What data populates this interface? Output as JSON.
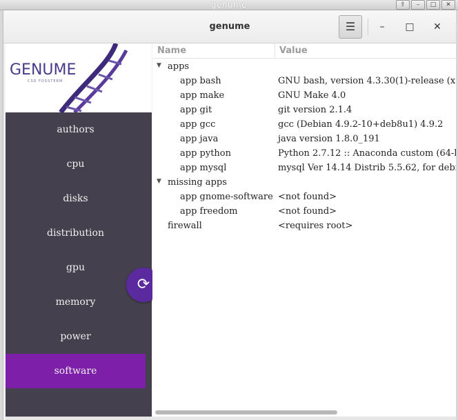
{
  "wm": {
    "title": "genume",
    "buttons": [
      "⇧",
      "–",
      "□",
      "✕"
    ]
  },
  "header": {
    "title": "genume",
    "menu_icon": "☰",
    "minimize": "–",
    "maximize": "□",
    "close": "✕"
  },
  "logo": {
    "text": "GENUME",
    "subtext": "CSD FOSSTERM"
  },
  "nav": {
    "items": [
      "authors",
      "cpu",
      "disks",
      "distribution",
      "gpu",
      "memory",
      "power",
      "software"
    ],
    "active": "software"
  },
  "fab": {
    "icon": "⟳"
  },
  "table": {
    "columns": {
      "name": "Name",
      "value": "Value"
    },
    "rows": [
      {
        "name": "apps",
        "value": "",
        "level": 0,
        "expander": "▼"
      },
      {
        "name": "app bash",
        "value": "GNU bash, version 4.3.30(1)-release (x",
        "level": 1
      },
      {
        "name": "app make",
        "value": "GNU Make 4.0",
        "level": 1
      },
      {
        "name": "app git",
        "value": "git version 2.1.4",
        "level": 1
      },
      {
        "name": "app gcc",
        "value": "gcc (Debian 4.9.2-10+deb8u1) 4.9.2",
        "level": 1
      },
      {
        "name": "app java",
        "value": "java version 1.8.0_191",
        "level": 1
      },
      {
        "name": "app python",
        "value": "Python 2.7.12 :: Anaconda custom (64-b",
        "level": 1
      },
      {
        "name": "app mysql",
        "value": "mysql Ver 14.14 Distrib 5.5.62, for debi",
        "level": 1
      },
      {
        "name": "missing apps",
        "value": "",
        "level": 0,
        "expander": "▼"
      },
      {
        "name": "app gnome-software",
        "value": "<not found>",
        "level": 1
      },
      {
        "name": "app freedom",
        "value": "<not found>",
        "level": 1
      },
      {
        "name": "firewall",
        "value": "<requires root>",
        "level": 0
      }
    ]
  },
  "colors": {
    "sidebar": "#45404e",
    "active": "#7d1fa8",
    "fab": "#5a2a9e"
  }
}
